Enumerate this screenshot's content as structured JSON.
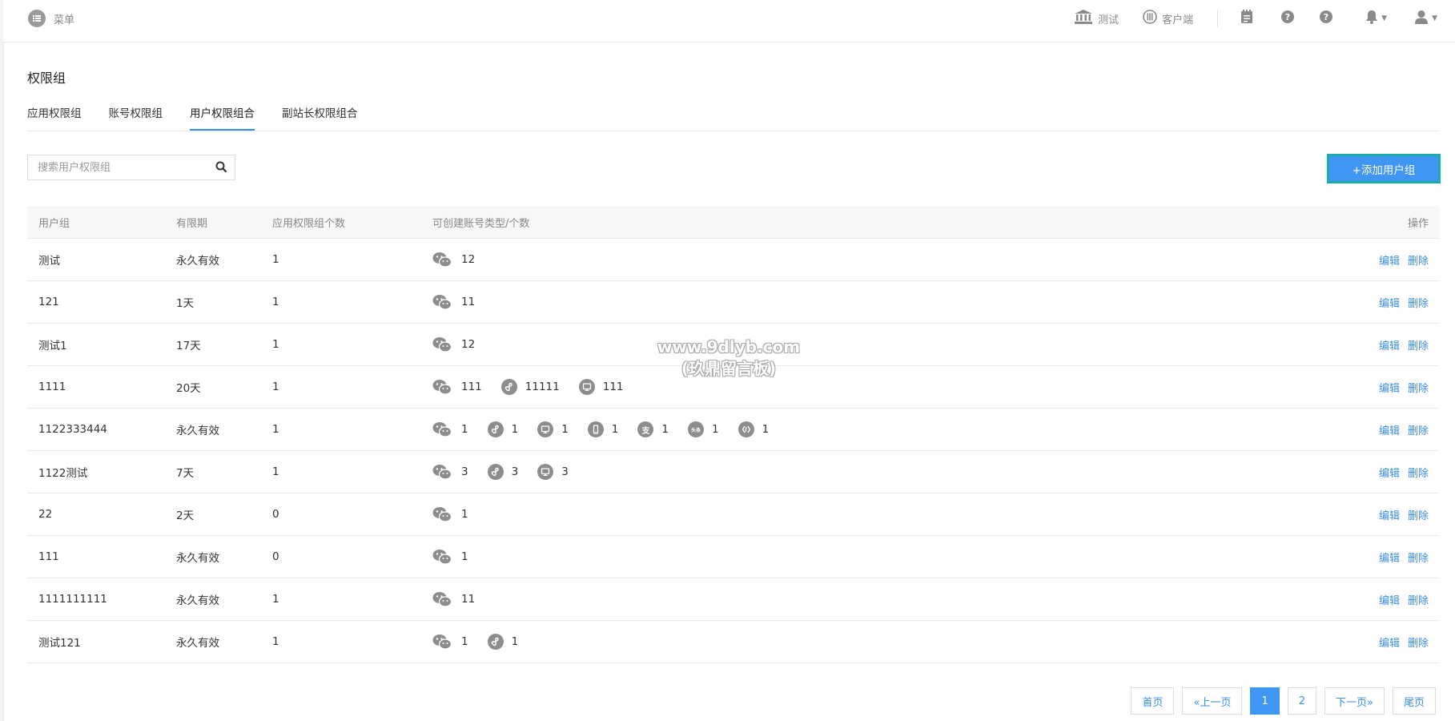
{
  "header": {
    "menu_label": "菜单",
    "site_label": "测试",
    "client_label": "客户端"
  },
  "page": {
    "title": "权限组",
    "tabs": [
      {
        "label": "应用权限组",
        "active": false
      },
      {
        "label": "账号权限组",
        "active": false
      },
      {
        "label": "用户权限组合",
        "active": true
      },
      {
        "label": "副站长权限组合",
        "active": false
      }
    ],
    "search_placeholder": "搜索用户权限组",
    "add_button": "+添加用户组"
  },
  "table": {
    "columns": [
      "用户组",
      "有限期",
      "应用权限组个数",
      "可创建账号类型/个数",
      "操作"
    ],
    "rows": [
      {
        "name": "测试",
        "validity": "永久有效",
        "app_groups": "1",
        "accounts": [
          {
            "icon": "wechat-icon",
            "count": "12"
          }
        ]
      },
      {
        "name": "121",
        "validity": "1天",
        "app_groups": "1",
        "accounts": [
          {
            "icon": "wechat-icon",
            "count": "11"
          }
        ]
      },
      {
        "name": "测试1",
        "validity": "17天",
        "app_groups": "1",
        "accounts": [
          {
            "icon": "wechat-icon",
            "count": "12"
          }
        ]
      },
      {
        "name": "1111",
        "validity": "20天",
        "app_groups": "1",
        "accounts": [
          {
            "icon": "wechat-icon",
            "count": "111"
          },
          {
            "icon": "mini-program-icon",
            "count": "11111"
          },
          {
            "icon": "pc-icon",
            "count": "111"
          }
        ]
      },
      {
        "name": "1122333444",
        "validity": "永久有效",
        "app_groups": "1",
        "accounts": [
          {
            "icon": "wechat-icon",
            "count": "1"
          },
          {
            "icon": "mini-program-icon",
            "count": "1"
          },
          {
            "icon": "pc-icon",
            "count": "1"
          },
          {
            "icon": "mobile-icon",
            "count": "1"
          },
          {
            "icon": "alipay-icon",
            "count": "1"
          },
          {
            "icon": "baidu-icon",
            "count": "1"
          },
          {
            "icon": "toutiao-icon",
            "count": "1"
          }
        ]
      },
      {
        "name": "1122测试",
        "validity": "7天",
        "app_groups": "1",
        "accounts": [
          {
            "icon": "wechat-icon",
            "count": "3"
          },
          {
            "icon": "mini-program-icon",
            "count": "3"
          },
          {
            "icon": "pc-icon",
            "count": "3"
          }
        ]
      },
      {
        "name": "22",
        "validity": "2天",
        "app_groups": "0",
        "accounts": [
          {
            "icon": "wechat-icon",
            "count": "1"
          }
        ]
      },
      {
        "name": "111",
        "validity": "永久有效",
        "app_groups": "0",
        "accounts": [
          {
            "icon": "wechat-icon",
            "count": "1"
          }
        ]
      },
      {
        "name": "1111111111",
        "validity": "永久有效",
        "app_groups": "1",
        "accounts": [
          {
            "icon": "wechat-icon",
            "count": "11"
          }
        ]
      },
      {
        "name": "测试121",
        "validity": "永久有效",
        "app_groups": "1",
        "accounts": [
          {
            "icon": "wechat-icon",
            "count": "1"
          },
          {
            "icon": "mini-program-icon",
            "count": "1"
          }
        ]
      }
    ],
    "actions": {
      "edit": "编辑",
      "delete": "删除"
    }
  },
  "pagination": {
    "first": "首页",
    "prev": "«上一页",
    "pages": [
      "1",
      "2"
    ],
    "current": "1",
    "next": "下一页»",
    "last": "尾页"
  },
  "watermark": {
    "line1": "www.9dlyb.com",
    "line2": "(玖鼎留言板)"
  }
}
